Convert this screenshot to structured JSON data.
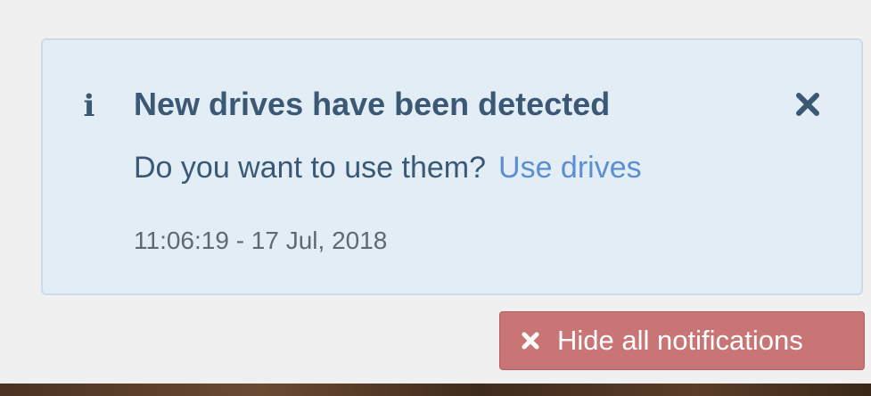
{
  "notification": {
    "icon": "info-icon",
    "title": "New drives have been detected",
    "message": "Do you want to use them?",
    "action_label": "Use drives",
    "timestamp": "11:06:19 - 17 Jul, 2018",
    "close_icon": "close-icon"
  },
  "hide_all": {
    "icon": "close-icon",
    "label": "Hide all notifications"
  },
  "colors": {
    "notification_bg": "#e2edf5",
    "notification_border": "#c8dcea",
    "title": "#3b5874",
    "link": "#5b8fd0",
    "timestamp": "#5e6a72",
    "hide_all_bg": "#c97575"
  }
}
